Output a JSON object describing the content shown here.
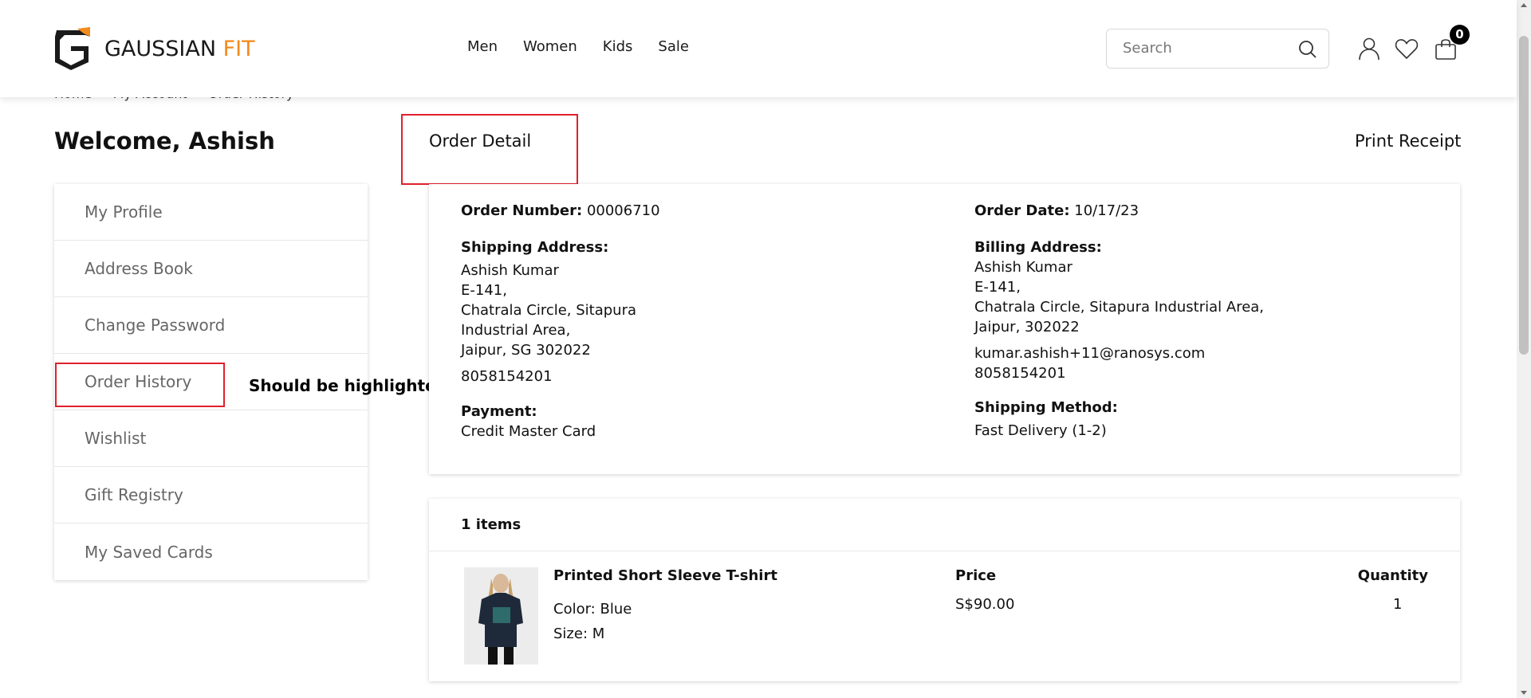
{
  "brand": {
    "name_part1": "GAUSSIAN",
    "name_part2": " FIT",
    "accent_color": "#f28a1c"
  },
  "nav": {
    "items": [
      "Men",
      "Women",
      "Kids",
      "Sale"
    ]
  },
  "search": {
    "placeholder": "Search"
  },
  "header_icons": [
    "user-icon",
    "heart-icon",
    "cart-icon"
  ],
  "cart": {
    "count": "0"
  },
  "breadcrumb": [
    "Home",
    "My Account",
    "Order History"
  ],
  "welcome": "Welcome, Ashish",
  "sidebar": {
    "items": [
      {
        "label": "My Profile"
      },
      {
        "label": "Address Book"
      },
      {
        "label": "Change Password"
      },
      {
        "label": "Order History"
      },
      {
        "label": "Wishlist"
      },
      {
        "label": "Gift Registry"
      },
      {
        "label": "My Saved Cards"
      }
    ]
  },
  "annotation": {
    "text": "Should be highlighted",
    "color": "#e0202c"
  },
  "order": {
    "title": "Order Detail",
    "print_label": "Print Receipt",
    "number_label": "Order Number:",
    "number": " 00006710",
    "date_label": "Order Date:",
    "date": " 10/17/23",
    "shipping_label": "Shipping Address:",
    "shipping_lines": [
      "Ashish Kumar",
      "E-141,",
      "Chatrala Circle, Sitapura",
      "Industrial Area,",
      "Jaipur, SG 302022"
    ],
    "shipping_phone": "8058154201",
    "billing_label": "Billing Address:",
    "billing_lines": [
      "Ashish Kumar",
      "E-141,",
      "Chatrala Circle, Sitapura Industrial Area,",
      "Jaipur, 302022"
    ],
    "billing_email": "kumar.ashish+11@ranosys.com",
    "billing_phone": "8058154201",
    "payment_label": "Payment:",
    "payment": "Credit Master Card",
    "shipping_method_label": "Shipping Method:",
    "shipping_method": "Fast Delivery (1-2)"
  },
  "items": {
    "count_label": "1 items",
    "products": [
      {
        "name": "Printed Short Sleeve T-shirt",
        "color": "Color: Blue",
        "size": "Size: M",
        "price_header": "Price",
        "price": "S$90.00",
        "qty_header": "Quantity",
        "qty": "1"
      }
    ]
  }
}
